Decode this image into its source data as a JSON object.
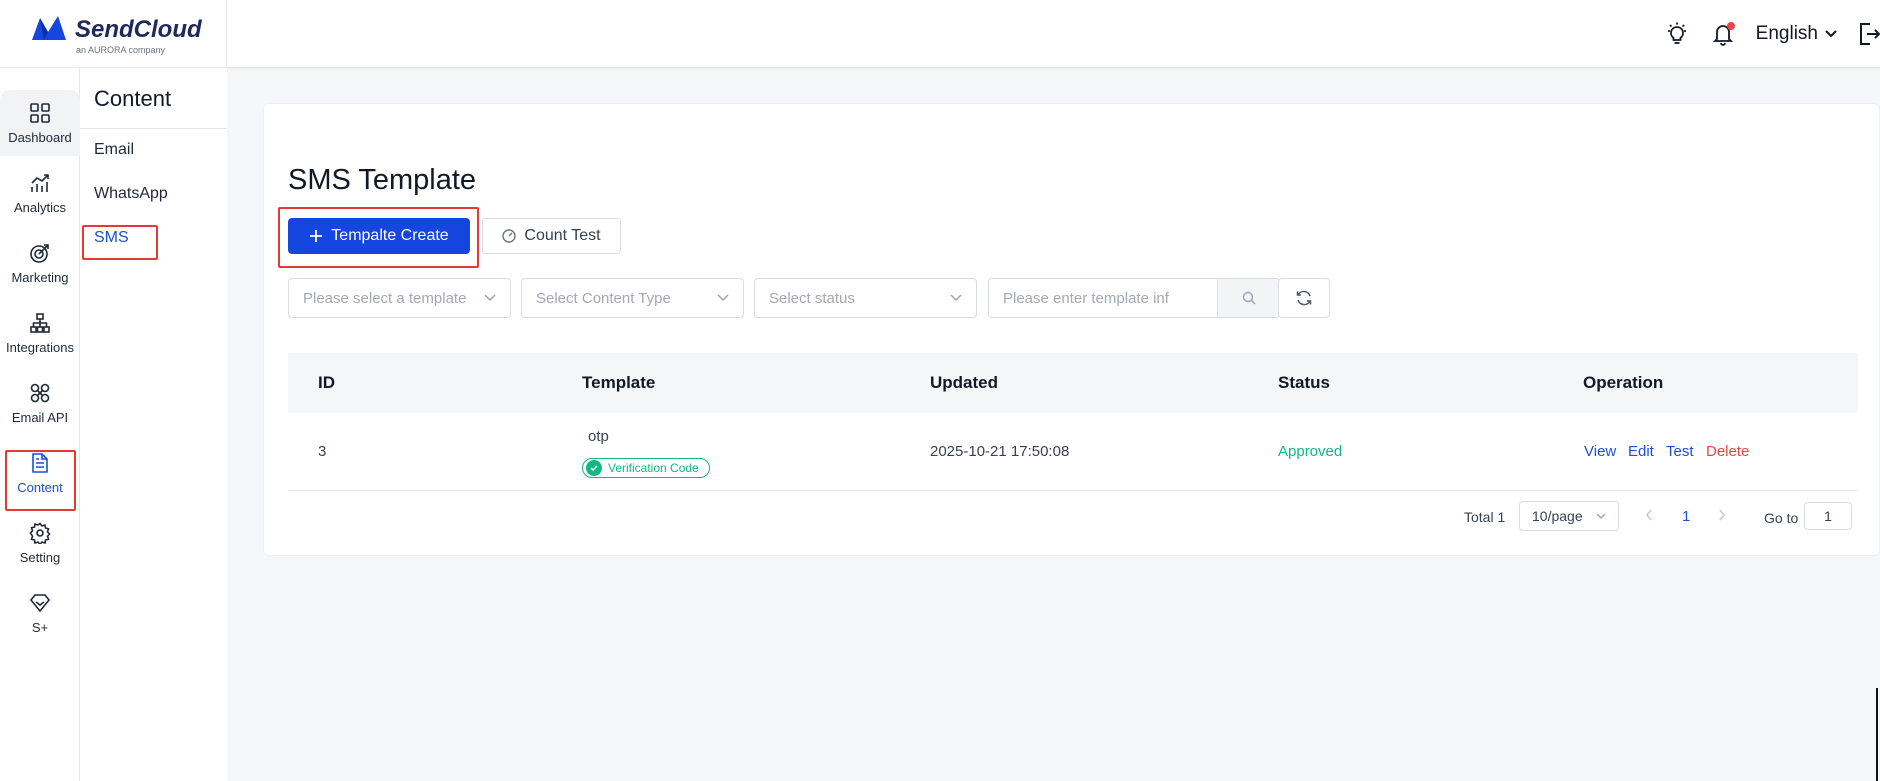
{
  "brand": {
    "name": "SendCloud",
    "tagline": "an AURORA company",
    "color": "#1546e0"
  },
  "header": {
    "icons": [
      "lightbulb-icon",
      "bell-icon"
    ],
    "language": "English",
    "logout_icon": "logout-icon"
  },
  "rail": {
    "items": [
      {
        "label": "Dashboard",
        "icon": "dashboard-icon"
      },
      {
        "label": "Analytics",
        "icon": "analytics-icon"
      },
      {
        "label": "Marketing",
        "icon": "marketing-icon"
      },
      {
        "label": "Integrations",
        "icon": "integrations-icon"
      },
      {
        "label": "Email API",
        "icon": "email-api-icon"
      },
      {
        "label": "Content",
        "icon": "content-icon",
        "active": true
      },
      {
        "label": "Setting",
        "icon": "gear-icon"
      },
      {
        "label": "S+",
        "icon": "diamond-icon"
      }
    ]
  },
  "subnav": {
    "title": "Content",
    "items": [
      {
        "label": "Email"
      },
      {
        "label": "WhatsApp"
      },
      {
        "label": "SMS",
        "active": true
      }
    ]
  },
  "main": {
    "title": "SMS Template",
    "create_button": "Tempalte Create",
    "count_test_button": "Count Test",
    "filters": {
      "template_placeholder": "Please select a template",
      "content_type_placeholder": "Select Content Type",
      "status_placeholder": "Select status",
      "search_placeholder": "Please enter template inf"
    },
    "table": {
      "columns": [
        "ID",
        "Template",
        "Updated",
        "Status",
        "Operation"
      ],
      "rows": [
        {
          "id": "3",
          "template_name": "otp",
          "template_tag": "Verification Code",
          "updated": "2025-10-21 17:50:08",
          "status": "Approved",
          "operations": [
            "View",
            "Edit",
            "Test",
            "Delete"
          ]
        }
      ]
    },
    "pagination": {
      "total": "Total 1",
      "page_size": "10/page",
      "current_page": "1",
      "goto_label": "Go to",
      "goto_value": "1"
    }
  },
  "colors": {
    "primary": "#1546e0",
    "success": "#10b981",
    "danger": "#ef4444",
    "highlight": "#e53935"
  }
}
